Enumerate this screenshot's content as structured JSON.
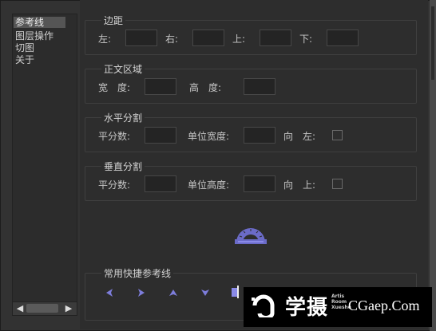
{
  "sidebar": {
    "items": [
      {
        "label": "参考线",
        "active": true
      },
      {
        "label": "图层操作",
        "active": false
      },
      {
        "label": "切图",
        "active": false
      },
      {
        "label": "关于",
        "active": false
      }
    ],
    "scroll_left": "◀",
    "scroll_right": "▶"
  },
  "margins": {
    "title": "边距",
    "left_label": "左:",
    "right_label": "右:",
    "top_label": "上:",
    "bottom_label": "下:",
    "left_value": "",
    "right_value": "",
    "top_value": "",
    "bottom_value": ""
  },
  "body_area": {
    "title": "正文区域",
    "width_label": "宽　度:",
    "height_label": "高　度:",
    "width_value": "",
    "height_value": ""
  },
  "hsplit": {
    "title": "水平分割",
    "count_label": "平分数:",
    "unit_label": "单位宽度:",
    "dir_label": "向　左:",
    "count_value": "",
    "unit_value": "",
    "checked": false
  },
  "vsplit": {
    "title": "垂直分割",
    "count_label": "平分数:",
    "unit_label": "单位高度:",
    "dir_label": "向　上:",
    "count_value": "",
    "unit_value": "",
    "checked": false
  },
  "quick_guides": {
    "title": "常用快捷参考线"
  },
  "watermark": {
    "brand": "学摄",
    "small_line1": "Artis",
    "small_line2": "Room",
    "small_line3": "Xueshe",
    "site": "CGaep.Com"
  },
  "colors": {
    "accent": "#7d7ddb",
    "panel": "#2d2d2d",
    "field": "#242424"
  },
  "icons": [
    "protractor-icon",
    "arrow-left-icon",
    "arrow-right-icon",
    "arrow-up-icon",
    "arrow-down-icon"
  ]
}
